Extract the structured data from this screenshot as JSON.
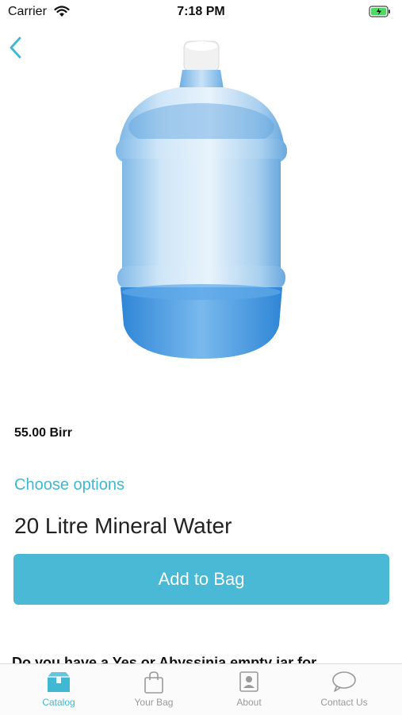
{
  "status_bar": {
    "carrier": "Carrier",
    "time": "7:18 PM",
    "wifi_icon": "wifi-icon",
    "battery_icon": "battery-charging-icon"
  },
  "nav": {
    "back_icon": "chevron-left-icon"
  },
  "product": {
    "image_icon": "water-bottle-image",
    "price": "55.00 Birr",
    "choose_options": "Choose options",
    "title": "20 Litre Mineral Water",
    "add_to_bag": "Add to Bag",
    "description_snippet": "Do you have a Yes or Abyssinia empty jar for"
  },
  "tabbar": {
    "items": [
      {
        "label": "Catalog",
        "icon": "box-icon",
        "active": true
      },
      {
        "label": "Your Bag",
        "icon": "bag-icon",
        "active": false
      },
      {
        "label": "About",
        "icon": "contact-card-icon",
        "active": false
      },
      {
        "label": "Contact Us",
        "icon": "chat-bubble-icon",
        "active": false
      }
    ]
  },
  "colors": {
    "accent": "#49b9d6",
    "accent_text": "#3fb8d4",
    "inactive": "#9a9a9a"
  }
}
